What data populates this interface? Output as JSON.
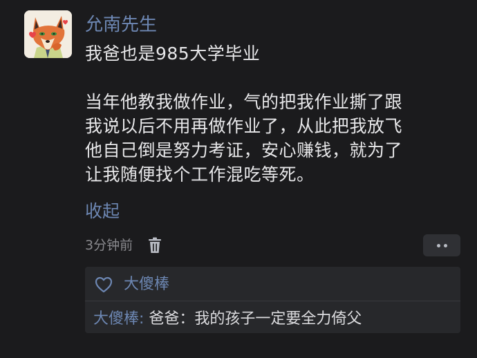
{
  "post": {
    "author": "允南先生",
    "avatar_icon": "fox-avatar-icon",
    "title_line": "我爸也是985大学毕业",
    "body_lines": [
      "当年他教我做作业，气的把我作业撕了跟",
      "我说以后不用再做作业了，从此把我放飞",
      "他自己倒是努力考证，安心赚钱，就为了",
      "让我随便找个工作混吃等死。"
    ],
    "collapse_label": "收起",
    "time": "3分钟前",
    "delete_icon": "trash-icon",
    "more_icon": "more-dots-icon"
  },
  "replies_box": {
    "like_icon": "heart-outline-icon",
    "liker": "大傻棒",
    "reply": {
      "author": "大傻棒:",
      "text": " 爸爸：我的孩子一定要全力倚父"
    }
  },
  "colors": {
    "background": "#1b1b1d",
    "link": "#6d87b3",
    "text": "#e8e8ea",
    "muted": "#8a8a8e",
    "panel": "#27282b"
  }
}
